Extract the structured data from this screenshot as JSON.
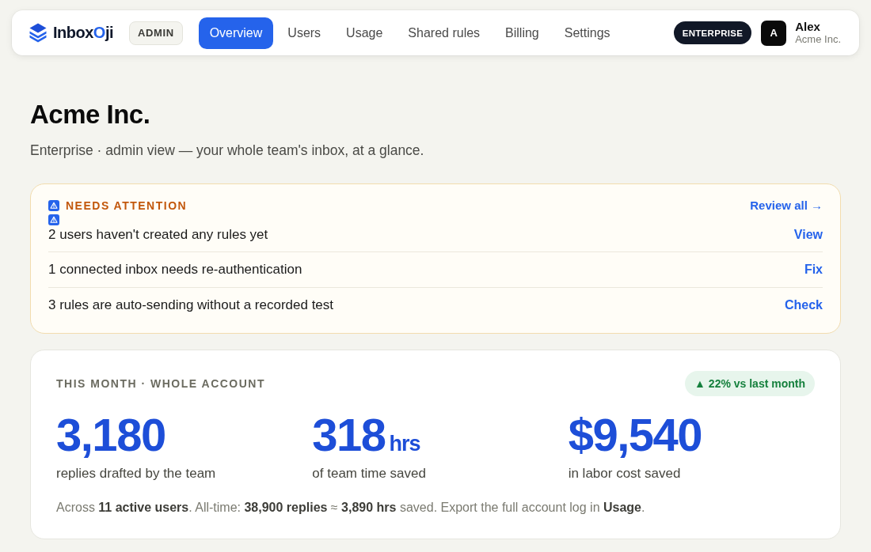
{
  "nav": {
    "logo": {
      "parts": [
        {
          "text": "Inbox",
          "accent": false
        },
        {
          "text": "O",
          "accent": true
        },
        {
          "text": "ji",
          "accent": false
        }
      ]
    },
    "role_badge": "ADMIN",
    "tabs": [
      {
        "label": "Overview",
        "selected": true
      },
      {
        "label": "Users",
        "selected": false
      },
      {
        "label": "Usage",
        "selected": false
      },
      {
        "label": "Shared rules",
        "selected": false
      },
      {
        "label": "Billing",
        "selected": false
      },
      {
        "label": "Settings",
        "selected": false
      }
    ],
    "plan_badge": "ENTERPRISE",
    "user": {
      "initial": "A",
      "name": "Alex",
      "org": "Acme Inc."
    }
  },
  "page": {
    "title": "Acme Inc.",
    "subtitle": "Enterprise · admin view — your whole team's inbox, at a glance."
  },
  "attention": {
    "heading": "NEEDS ATTENTION",
    "review_link": "Review all →",
    "items": [
      {
        "text": "2 users haven't created any rules yet",
        "action": "View",
        "warning_icon": true
      },
      {
        "text": "1 connected inbox needs re-authentication",
        "action": "Fix",
        "warning_icon": false
      },
      {
        "text": "3 rules are auto-sending without a recorded test",
        "action": "Check",
        "warning_icon": false
      }
    ]
  },
  "stats": {
    "heading": "THIS MONTH · WHOLE ACCOUNT",
    "trend": "▲ 22% vs last month",
    "metrics": [
      {
        "value": "3,180",
        "caption": "replies drafted by the team"
      },
      {
        "value": "318",
        "unit": "hrs",
        "caption": "of team time saved"
      },
      {
        "value": "$9,540",
        "caption": "in labor cost saved"
      }
    ],
    "footnote": "Across **11 active users**. All-time: **38,900 replies** ≈ **3,890 hrs** saved. Export the full account log in **Usage**."
  }
}
